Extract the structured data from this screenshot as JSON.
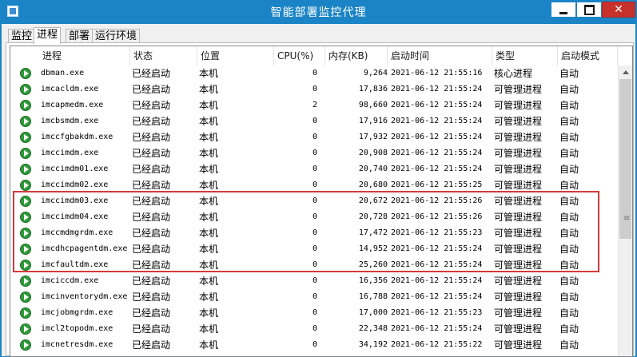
{
  "window": {
    "title": "智能部署监控代理",
    "minimize_label": "",
    "maximize_label": "",
    "close_label": "✕"
  },
  "tabs": [
    {
      "label": "监控",
      "active": false
    },
    {
      "label": "进程",
      "active": true
    },
    {
      "label": "部署",
      "active": false
    },
    {
      "label": "运行环境",
      "active": false
    }
  ],
  "table": {
    "columns": [
      "进程",
      "状态",
      "位置",
      "CPU(%)",
      "内存(KB)",
      "启动时间",
      "类型",
      "启动模式"
    ],
    "rows": [
      {
        "name": "dbman.exe",
        "status": "已经启动",
        "location": "本机",
        "cpu": "0",
        "memory": "9,264",
        "start_time": "2021-06-12 21:55:16",
        "type": "核心进程",
        "mode": "自动"
      },
      {
        "name": "imcacldm.exe",
        "status": "已经启动",
        "location": "本机",
        "cpu": "0",
        "memory": "17,836",
        "start_time": "2021-06-12 21:55:24",
        "type": "可管理进程",
        "mode": "自动"
      },
      {
        "name": "imcapmedm.exe",
        "status": "已经启动",
        "location": "本机",
        "cpu": "2",
        "memory": "98,660",
        "start_time": "2021-06-12 21:55:24",
        "type": "可管理进程",
        "mode": "自动"
      },
      {
        "name": "imcbsmdm.exe",
        "status": "已经启动",
        "location": "本机",
        "cpu": "0",
        "memory": "17,916",
        "start_time": "2021-06-12 21:55:24",
        "type": "可管理进程",
        "mode": "自动"
      },
      {
        "name": "imccfgbakdm.exe",
        "status": "已经启动",
        "location": "本机",
        "cpu": "0",
        "memory": "17,932",
        "start_time": "2021-06-12 21:55:24",
        "type": "可管理进程",
        "mode": "自动"
      },
      {
        "name": "imccimdm.exe",
        "status": "已经启动",
        "location": "本机",
        "cpu": "0",
        "memory": "20,908",
        "start_time": "2021-06-12 21:55:24",
        "type": "可管理进程",
        "mode": "自动"
      },
      {
        "name": "imccimdm01.exe",
        "status": "已经启动",
        "location": "本机",
        "cpu": "0",
        "memory": "20,740",
        "start_time": "2021-06-12 21:55:24",
        "type": "可管理进程",
        "mode": "自动"
      },
      {
        "name": "imccimdm02.exe",
        "status": "已经启动",
        "location": "本机",
        "cpu": "0",
        "memory": "20,680",
        "start_time": "2021-06-12 21:55:25",
        "type": "可管理进程",
        "mode": "自动"
      },
      {
        "name": "imccimdm03.exe",
        "status": "已经启动",
        "location": "本机",
        "cpu": "0",
        "memory": "20,672",
        "start_time": "2021-06-12 21:55:26",
        "type": "可管理进程",
        "mode": "自动"
      },
      {
        "name": "imccimdm04.exe",
        "status": "已经启动",
        "location": "本机",
        "cpu": "0",
        "memory": "20,728",
        "start_time": "2021-06-12 21:55:26",
        "type": "可管理进程",
        "mode": "自动"
      },
      {
        "name": "imccmdmgrdm.exe",
        "status": "已经启动",
        "location": "本机",
        "cpu": "0",
        "memory": "17,472",
        "start_time": "2021-06-12 21:55:23",
        "type": "可管理进程",
        "mode": "自动"
      },
      {
        "name": "imcdhcpagentdm.exe",
        "status": "已经启动",
        "location": "本机",
        "cpu": "0",
        "memory": "14,952",
        "start_time": "2021-06-12 21:55:24",
        "type": "可管理进程",
        "mode": "自动"
      },
      {
        "name": "imcfaultdm.exe",
        "status": "已经启动",
        "location": "本机",
        "cpu": "0",
        "memory": "25,260",
        "start_time": "2021-06-12 21:55:24",
        "type": "可管理进程",
        "mode": "自动"
      },
      {
        "name": "imciccdm.exe",
        "status": "已经启动",
        "location": "本机",
        "cpu": "0",
        "memory": "16,356",
        "start_time": "2021-06-12 21:55:24",
        "type": "可管理进程",
        "mode": "自动"
      },
      {
        "name": "imcinventorydm.exe",
        "status": "已经启动",
        "location": "本机",
        "cpu": "0",
        "memory": "16,788",
        "start_time": "2021-06-12 21:55:24",
        "type": "可管理进程",
        "mode": "自动"
      },
      {
        "name": "imcjobmgrdm.exe",
        "status": "已经启动",
        "location": "本机",
        "cpu": "0",
        "memory": "17,000",
        "start_time": "2021-06-12 21:55:23",
        "type": "可管理进程",
        "mode": "自动"
      },
      {
        "name": "imcl2topodm.exe",
        "status": "已经启动",
        "location": "本机",
        "cpu": "0",
        "memory": "22,348",
        "start_time": "2021-06-12 21:55:24",
        "type": "可管理进程",
        "mode": "自动"
      },
      {
        "name": "imcnetresdm.exe",
        "status": "已经启动",
        "location": "本机",
        "cpu": "0",
        "memory": "34,192",
        "start_time": "2021-06-12 21:55:22",
        "type": "可管理进程",
        "mode": "自动"
      }
    ]
  },
  "icons": {
    "app": "app-icon",
    "process_status": "running-play-icon",
    "scroll_up": "scroll-up-arrow-icon",
    "thumb_grip": "scroll-grip-icon"
  },
  "colors": {
    "titlebar": "#1b84c6",
    "close_button": "#c7312c",
    "status_green": "#2f9a3a",
    "highlight_box": "#d33a3a"
  }
}
